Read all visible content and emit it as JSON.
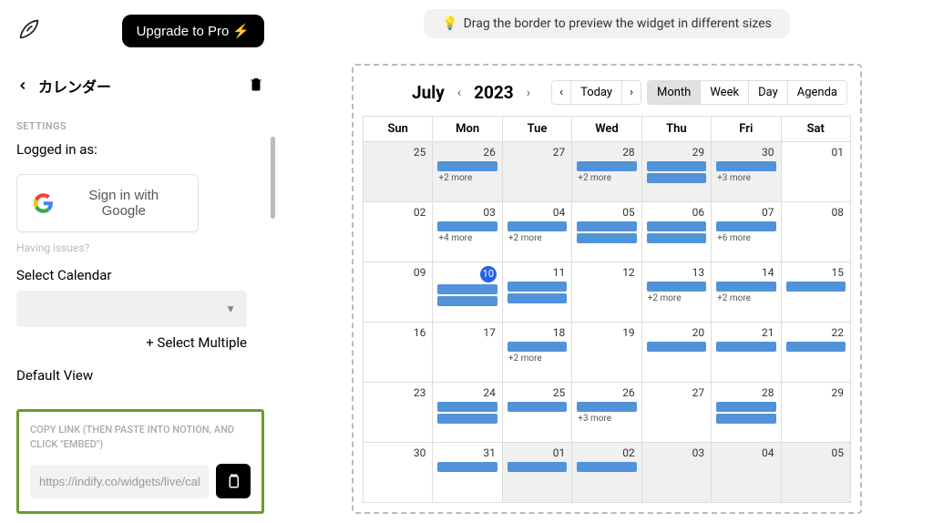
{
  "sidebar": {
    "upgrade_label": "Upgrade to Pro",
    "title": "カレンダー",
    "settings_label": "SETTINGS",
    "logged_in_label": "Logged in as:",
    "google_label": "Sign in with Google",
    "having_issues": "Having issues?",
    "select_calendar_label": "Select Calendar",
    "select_multiple_label": "+ Select Multiple",
    "default_view_label": "Default View",
    "copy_label": "COPY LINK (THEN PASTE INTO NOTION, AND CLICK \"EMBED\")",
    "copy_url": "https://indify.co/widgets/live/calenda"
  },
  "hint": "Drag the border to preview the widget in different sizes",
  "calendar": {
    "month": "July",
    "year": "2023",
    "today_label": "Today",
    "views": {
      "month": "Month",
      "week": "Week",
      "day": "Day",
      "agenda": "Agenda"
    },
    "active_view": "Month",
    "weekdays": [
      "Sun",
      "Mon",
      "Tue",
      "Wed",
      "Thu",
      "Fri",
      "Sat"
    ],
    "today_day": 10,
    "cells": [
      [
        {
          "n": 25,
          "off": true
        },
        {
          "n": 26,
          "off": true,
          "bars": 1,
          "more": "+2 more"
        },
        {
          "n": 27,
          "off": true
        },
        {
          "n": 28,
          "off": true,
          "bars": 1,
          "more": "+2 more"
        },
        {
          "n": 29,
          "off": true,
          "bars": 2
        },
        {
          "n": 30,
          "off": true,
          "bars": 1,
          "more": "+3 more"
        },
        {
          "n": "01"
        }
      ],
      [
        {
          "n": "02"
        },
        {
          "n": "03",
          "bars": 1,
          "more": "+4 more"
        },
        {
          "n": "04",
          "bars": 1,
          "more": "+2 more"
        },
        {
          "n": "05",
          "bars": 2
        },
        {
          "n": "06",
          "bars": 2
        },
        {
          "n": "07",
          "bars": 1,
          "more": "+6 more"
        },
        {
          "n": "08"
        }
      ],
      [
        {
          "n": "09"
        },
        {
          "n": 10,
          "today": true,
          "bars": 2
        },
        {
          "n": 11,
          "bars": 2
        },
        {
          "n": 12
        },
        {
          "n": 13,
          "bars": 1,
          "more": "+2 more"
        },
        {
          "n": 14,
          "bars": 1,
          "more": "+2 more"
        },
        {
          "n": 15,
          "bars": 1
        }
      ],
      [
        {
          "n": 16
        },
        {
          "n": 17
        },
        {
          "n": 18,
          "bars": 1,
          "more": "+2 more"
        },
        {
          "n": 19
        },
        {
          "n": 20,
          "bars": 1
        },
        {
          "n": 21,
          "bars": 1
        },
        {
          "n": 22,
          "bars": 1
        }
      ],
      [
        {
          "n": 23
        },
        {
          "n": 24,
          "bars": 2
        },
        {
          "n": 25,
          "bars": 1
        },
        {
          "n": 26,
          "bars": 1,
          "more": "+3 more"
        },
        {
          "n": 27
        },
        {
          "n": 28,
          "bars": 2
        },
        {
          "n": 29
        }
      ],
      [
        {
          "n": 30
        },
        {
          "n": 31,
          "bars": 1
        },
        {
          "n": "01",
          "off": true,
          "bars": 1
        },
        {
          "n": "02",
          "off": true,
          "bars": 1
        },
        {
          "n": "03",
          "off": true
        },
        {
          "n": "04",
          "off": true
        },
        {
          "n": "05",
          "off": true
        }
      ]
    ]
  }
}
